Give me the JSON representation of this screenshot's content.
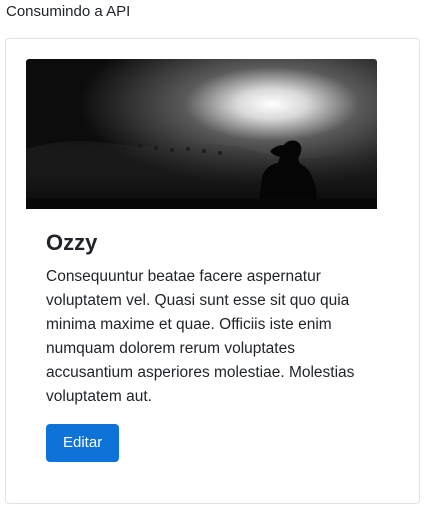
{
  "page": {
    "heading": "Consumindo a API"
  },
  "card": {
    "image_alt": "concert crowd photo",
    "title": "Ozzy",
    "text": "Consequuntur beatae facere aspernatur voluptatem vel. Quasi sunt esse sit quo quia minima maxime et quae. Officiis iste enim numquam dolorem rerum voluptates accusantium asperiores molestiae. Molestias voluptatem aut.",
    "button_label": "Editar",
    "button_color": "#0d73d9"
  }
}
